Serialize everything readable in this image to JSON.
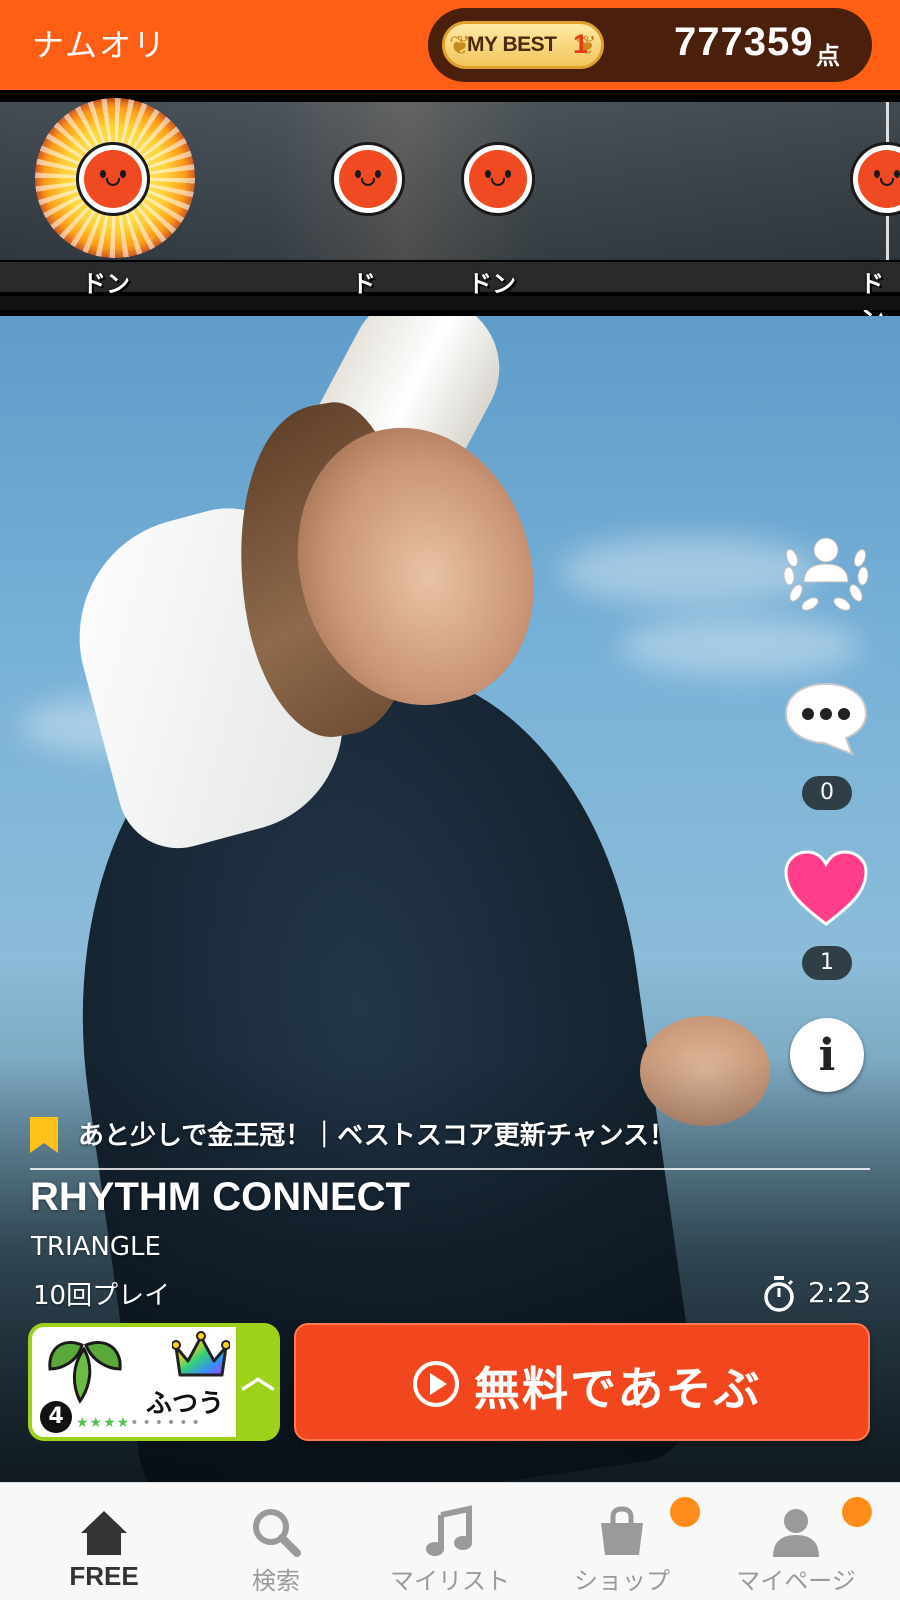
{
  "header": {
    "username": "ナムオリ",
    "best_label": "MY BEST",
    "best_rank": "1",
    "score": "777359",
    "score_unit": "点"
  },
  "lane": {
    "notes": [
      "ドン",
      "ド",
      "ドン",
      "ドン"
    ]
  },
  "side": {
    "comment_count": "0",
    "like_count": "1",
    "info_glyph": "i"
  },
  "song": {
    "promo": "あと少しで金王冠！｜ベストスコア更新チャンス！",
    "title": "RHYTHM CONNECT",
    "artist": "TRIANGLE",
    "plays": "10回プレイ",
    "duration": "2:23"
  },
  "difficulty": {
    "name": "ふつう",
    "level": "4",
    "expand_glyph": "^"
  },
  "play_button": {
    "label": "無料であそぶ"
  },
  "nav": {
    "items": [
      {
        "label": "FREE"
      },
      {
        "label": "検索"
      },
      {
        "label": "マイリスト"
      },
      {
        "label": "ショップ"
      },
      {
        "label": "マイページ"
      }
    ]
  },
  "colors": {
    "header_orange": "#ff5f14",
    "play_red": "#f2471e",
    "difficulty_green": "#9ed21a",
    "heart_pink": "#ff3d8a",
    "notification_dot": "#ff8c1a"
  }
}
